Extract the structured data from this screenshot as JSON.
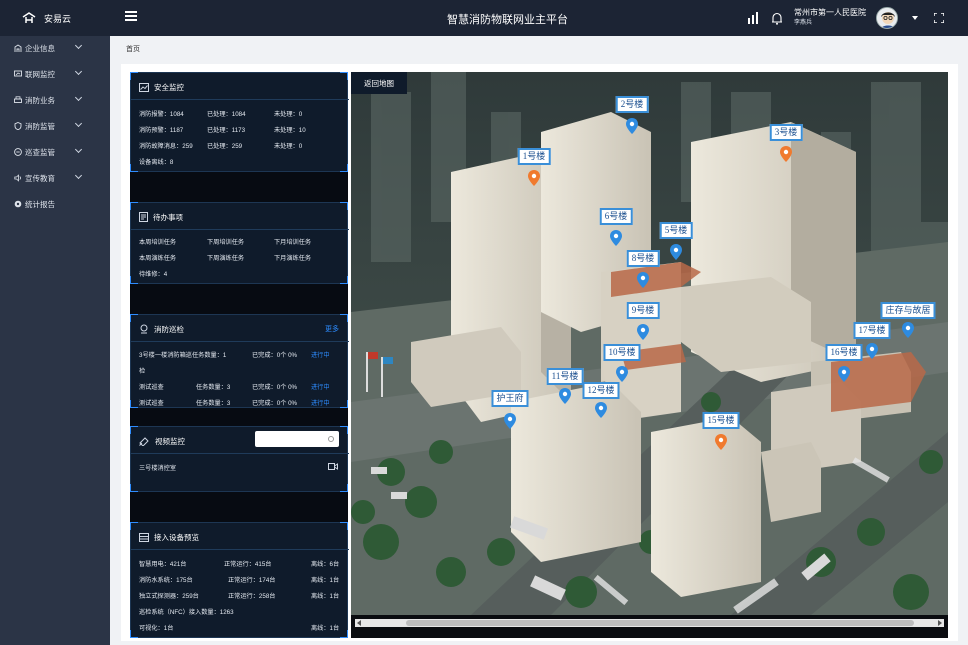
{
  "header": {
    "logo_text": "安易云",
    "app_title": "智慧消防物联网业主平台",
    "org_name": "常州市第一人民医院",
    "user_name": "李燕兵"
  },
  "sidebar": {
    "items": [
      {
        "label": "企业信息",
        "icon": "building-icon"
      },
      {
        "label": "联网监控",
        "icon": "monitor-icon"
      },
      {
        "label": "消防业务",
        "icon": "printer-icon"
      },
      {
        "label": "消防监管",
        "icon": "shield-icon"
      },
      {
        "label": "巡查监管",
        "icon": "inspect-icon"
      },
      {
        "label": "宣传教育",
        "icon": "speaker-icon"
      },
      {
        "label": "统计报告",
        "icon": "gear-icon"
      }
    ]
  },
  "breadcrumb": "首页",
  "safety": {
    "title": "安全监控",
    "r1": {
      "a": "消防报警：1084",
      "b": "已处理：1084",
      "c": "未处理：0"
    },
    "r2": {
      "a": "消防预警：1187",
      "b": "已处理：1173",
      "c": "未处理：10"
    },
    "r3": {
      "a": "消防故障消息：259",
      "b": "已处理：259",
      "c": "未处理：0"
    },
    "r4": "设备离线：8"
  },
  "todo": {
    "title": "待办事项",
    "r1": {
      "a": "本周培训任务",
      "b": "下周培训任务",
      "c": "下月培训任务"
    },
    "r2": {
      "a": "本周演练任务",
      "b": "下周演练任务",
      "c": "下月演练任务"
    },
    "r3": "待维修：4"
  },
  "patrol": {
    "title": "消防巡检",
    "more": "更多",
    "rows": [
      {
        "a": "3号楼一楼消防箱巡任务数量：1",
        "b": "已完成：0个 0%",
        "c": "进行中",
        "cont": "检"
      },
      {
        "a": "测试巡查",
        "t": "任务数量：3",
        "b": "已完成：0个 0%",
        "c": "进行中"
      },
      {
        "a": "测试巡查",
        "t": "任务数量：3",
        "b": "已完成：0个 0%",
        "c": "进行中"
      }
    ]
  },
  "video": {
    "title": "视频监控",
    "search_placeholder": "",
    "item": "三号楼消控室"
  },
  "devices": {
    "title": "接入设备预览",
    "rows": [
      {
        "a": "智慧用电：421台",
        "b": "正常运行：415台",
        "c": "离线：6台"
      },
      {
        "a": "消防水系统：175台",
        "b": "正常运行：174台",
        "c": "离线：1台"
      },
      {
        "a": "独立式探测器：259台",
        "b": "正常运行：258台",
        "c": "离线：1台"
      },
      {
        "a": "巡检系统（NFC）接入数量：1263"
      },
      {
        "a": "可视化：1台",
        "c": "离线：1台"
      }
    ]
  },
  "map": {
    "back_label": "返回地图",
    "markers": [
      {
        "label": "2号楼",
        "color": "#2e8be0"
      },
      {
        "label": "3号楼",
        "color": "#f07a2e"
      },
      {
        "label": "1号楼",
        "color": "#f07a2e"
      },
      {
        "label": "6号楼",
        "color": "#2e8be0"
      },
      {
        "label": "5号楼",
        "color": "#2e8be0"
      },
      {
        "label": "8号楼",
        "color": "#2e8be0"
      },
      {
        "label": "9号楼",
        "color": "#2e8be0"
      },
      {
        "label": "庄存与故居",
        "color": "#2e8be0"
      },
      {
        "label": "17号楼",
        "color": "#2e8be0"
      },
      {
        "label": "16号楼",
        "color": "#2e8be0"
      },
      {
        "label": "10号楼",
        "color": "#2e8be0"
      },
      {
        "label": "11号楼",
        "color": "#2e8be0"
      },
      {
        "label": "12号楼",
        "color": "#2e8be0"
      },
      {
        "label": "护王府",
        "color": "#2e8be0"
      },
      {
        "label": "15号楼",
        "color": "#f07a2e"
      }
    ]
  },
  "colors": {
    "topbar": "#1c2434",
    "sidebar": "#2b3446",
    "panel": "#0f1b2b",
    "accent": "#2d8cff"
  }
}
